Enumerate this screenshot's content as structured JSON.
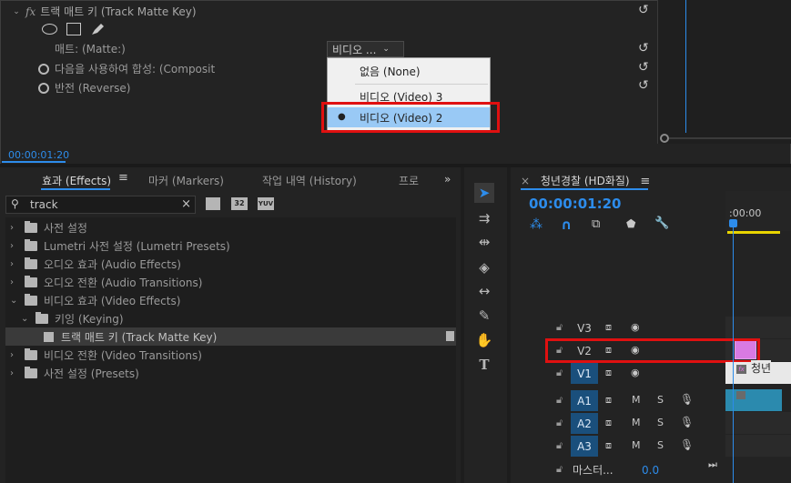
{
  "effect_controls": {
    "effect_title": "트랙 매트 키 (Track Matte Key)",
    "fx_label": "fx",
    "matte_label": "매트: (Matte:)",
    "matte_value": "비디오 ...",
    "composite_label": "다음을 사용하여 합성: (Composit",
    "reverse_label": "반전 (Reverse)",
    "timecode": "00:00:01:20",
    "reset_icon": "reset-icon",
    "dropdown_options": [
      {
        "label": "없음 (None)",
        "selected": false
      },
      {
        "label": "비디오 (Video) 3",
        "selected": false
      },
      {
        "label": "비디오 (Video) 2",
        "selected": true
      }
    ]
  },
  "effects_panel": {
    "tabs": [
      "효과 (Effects)",
      "마커 (Markers)",
      "작업 내역 (History)",
      "프로"
    ],
    "active_tab": "효과 (Effects)",
    "search_value": "track",
    "search_badges": [
      "32",
      "YUV"
    ],
    "tree": [
      {
        "label": "사전 설정",
        "expanded": false,
        "level": 0
      },
      {
        "label": "Lumetri 사전 설정 (Lumetri Presets)",
        "expanded": false,
        "level": 0
      },
      {
        "label": "오디오 효과 (Audio Effects)",
        "expanded": false,
        "level": 0
      },
      {
        "label": "오디오 전환 (Audio Transitions)",
        "expanded": false,
        "level": 0
      },
      {
        "label": "비디오 효과 (Video Effects)",
        "expanded": true,
        "level": 0
      },
      {
        "label": "키잉 (Keying)",
        "expanded": true,
        "level": 1
      },
      {
        "label": "트랙 매트 키 (Track Matte Key)",
        "expanded": false,
        "level": 2
      },
      {
        "label": "비디오 전환 (Video Transitions)",
        "expanded": false,
        "level": 0
      },
      {
        "label": "사전 설정 (Presets)",
        "expanded": false,
        "level": 0
      }
    ]
  },
  "timeline": {
    "sequence_name": "청년경찰 (HD화질)",
    "timecode": "00:00:01:20",
    "ruler_label": ":00:00",
    "tracks": [
      {
        "name": "V3",
        "active": false
      },
      {
        "name": "V2",
        "active": false
      },
      {
        "name": "V1",
        "active": true
      },
      {
        "name": "A1",
        "active": true
      },
      {
        "name": "A2",
        "active": true
      },
      {
        "name": "A3",
        "active": true
      }
    ],
    "audio_m": "M",
    "audio_s": "S",
    "clip_v1_label": "청년",
    "master_label": "마스터...",
    "master_value": "0.0"
  },
  "colors": {
    "accent": "#2d8ceb",
    "highlight_red": "#e01010",
    "clip_pink": "#d97ae2",
    "menu_selected": "#99c9f5"
  }
}
